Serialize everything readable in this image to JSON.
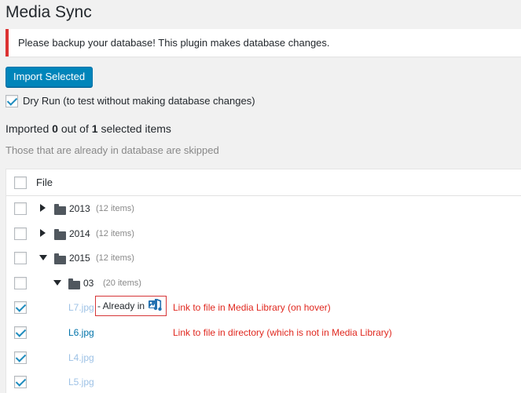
{
  "page": {
    "title": "Media Sync",
    "notice": "Please backup your database! This plugin makes database changes.",
    "import_button": "Import Selected",
    "dry_run_label": "Dry Run (to test without making database changes)",
    "imported_prefix": "Imported",
    "imported_count": "0",
    "imported_middle": "out of",
    "selected_count": "1",
    "imported_suffix": "selected items",
    "skipped_note": "Those that are already in database are skipped"
  },
  "table": {
    "header": "File",
    "rows": [
      {
        "name": "2013",
        "count": "(12 items)",
        "type": "folder",
        "expanded": false,
        "checked": false
      },
      {
        "name": "2014",
        "count": "(12 items)",
        "type": "folder",
        "expanded": false,
        "checked": false
      },
      {
        "name": "2015",
        "count": "(12 items)",
        "type": "folder",
        "expanded": true,
        "checked": false
      },
      {
        "name": "03",
        "count": "(20 items)",
        "type": "folder",
        "expanded": true,
        "checked": false
      },
      {
        "name": "L7.jpg",
        "type": "file",
        "checked": true,
        "status": "- Already in"
      },
      {
        "name": "L6.jpg",
        "type": "file",
        "checked": true
      },
      {
        "name": "L4.jpg",
        "type": "file",
        "checked": true
      },
      {
        "name": "L5.jpg",
        "type": "file",
        "checked": true
      }
    ]
  },
  "annotations": {
    "media_library_link": "Link to file in Media Library (on hover)",
    "directory_link": "Link to file in directory (which is not in Media Library)"
  },
  "colors": {
    "accent": "#0085ba",
    "notice_border": "#dc3232",
    "annotation": "#e0281f"
  },
  "icons": {
    "media_library": "media-library-icon",
    "folder": "folder-icon",
    "expand": "caret-right-icon",
    "collapse": "caret-down-icon"
  }
}
